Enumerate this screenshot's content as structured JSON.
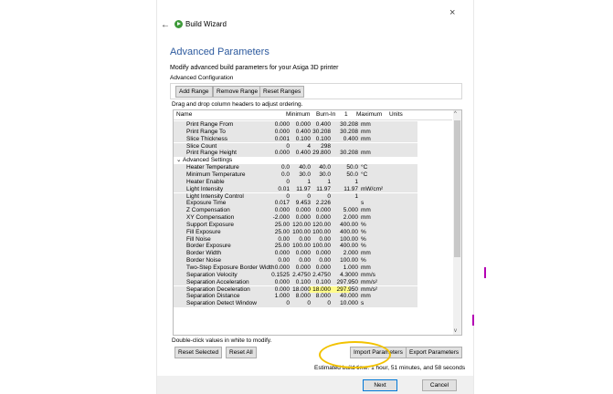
{
  "window": {
    "close_glyph": "×",
    "back_glyph": "←",
    "title": "Build Wizard"
  },
  "page": {
    "title": "Advanced Parameters",
    "description": "Modify advanced build parameters for your Asiga 3D printer",
    "group_label": "Advanced Configuration",
    "drag_hint": "Drag and drop column headers to adjust ordering.",
    "footer_note": "Double-click values in white to modify.",
    "estimated_time": "Estimated build time: 1 hour, 51 minutes, and 58 seconds"
  },
  "toolbar": {
    "add_range": "Add Range",
    "remove_range": "Remove Range",
    "reset_ranges": "Reset Ranges"
  },
  "bottom_buttons": {
    "reset_selected": "Reset Selected",
    "reset_all": "Reset All",
    "import_parameters": "Import Parameters",
    "export_parameters": "Export Parameters"
  },
  "nav": {
    "next": "Next",
    "cancel": "Cancel"
  },
  "table": {
    "columns": [
      "Name",
      "Minimum",
      "Burn-In",
      "1",
      "Maximum",
      "Units"
    ],
    "section_toggle": "⌄",
    "rows": [
      {
        "name": "Print Range From",
        "min": "0.000",
        "burn": "0.000",
        "one": "0.400",
        "max": "30.208",
        "unit": "mm"
      },
      {
        "name": "Print Range To",
        "min": "0.000",
        "burn": "0.400",
        "one": "30.208",
        "max": "30.208",
        "unit": "mm"
      },
      {
        "name": "Slice Thickness",
        "min": "0.001",
        "burn": "0.100",
        "one": "0.100",
        "max": "0.400",
        "unit": "mm"
      },
      {
        "name": "Slice Count",
        "min": "0",
        "burn": "4",
        "one": "298",
        "max": "",
        "unit": ""
      },
      {
        "name": "Print Range Height",
        "min": "0.000",
        "burn": "0.400",
        "one": "29.800",
        "max": "30.208",
        "unit": "mm"
      },
      {
        "name": "Advanced Settings",
        "section": true
      },
      {
        "name": "Heater Temperature",
        "min": "0.0",
        "burn": "40.0",
        "one": "40.0",
        "max": "50.0",
        "unit": "°C"
      },
      {
        "name": "Minimum Temperature",
        "min": "0.0",
        "burn": "30.0",
        "one": "30.0",
        "max": "50.0",
        "unit": "°C"
      },
      {
        "name": "Heater Enable",
        "min": "0",
        "burn": "1",
        "one": "1",
        "max": "1",
        "unit": ""
      },
      {
        "name": "Light Intensity",
        "min": "0.01",
        "burn": "11.97",
        "one": "11.97",
        "max": "11.97",
        "unit": "mW/cm²"
      },
      {
        "name": "Light Intensity Control",
        "min": "0",
        "burn": "0",
        "one": "0",
        "max": "1",
        "unit": ""
      },
      {
        "name": "Exposure Time",
        "min": "0.017",
        "burn": "9.453",
        "one": "2.226",
        "max": "",
        "unit": "s"
      },
      {
        "name": "Z Compensation",
        "min": "0.000",
        "burn": "0.000",
        "one": "0.000",
        "max": "5.000",
        "unit": "mm"
      },
      {
        "name": "XY Compensation",
        "min": "-2.000",
        "burn": "0.000",
        "one": "0.000",
        "max": "2.000",
        "unit": "mm"
      },
      {
        "name": "Support Exposure",
        "min": "25.00",
        "burn": "120.00",
        "one": "120.00",
        "max": "400.00",
        "unit": "%"
      },
      {
        "name": "Fill Exposure",
        "min": "25.00",
        "burn": "100.00",
        "one": "100.00",
        "max": "400.00",
        "unit": "%"
      },
      {
        "name": "Fill Noise",
        "min": "0.00",
        "burn": "0.00",
        "one": "0.00",
        "max": "100.00",
        "unit": "%"
      },
      {
        "name": "Border Exposure",
        "min": "25.00",
        "burn": "100.00",
        "one": "100.00",
        "max": "400.00",
        "unit": "%"
      },
      {
        "name": "Border Width",
        "min": "0.000",
        "burn": "0.000",
        "one": "0.000",
        "max": "2.000",
        "unit": "mm"
      },
      {
        "name": "Border Noise",
        "min": "0.00",
        "burn": "0.00",
        "one": "0.00",
        "max": "100.00",
        "unit": "%"
      },
      {
        "name": "Two-Step Exposure Border Width",
        "min": "0.000",
        "burn": "0.000",
        "one": "0.000",
        "max": "1.000",
        "unit": "mm"
      },
      {
        "name": "Separation Velocity",
        "min": "0.1525",
        "burn": "2.4750",
        "one": "2.4750",
        "max": "4.3000",
        "unit": "mm/s"
      },
      {
        "name": "Separation Acceleration",
        "min": "0.000",
        "burn": "0.100",
        "one": "0.100",
        "max": "297.950",
        "unit": "mm/s²"
      },
      {
        "name": "Separation Deceleration",
        "min": "0.000",
        "burn": "18.000",
        "one": "18.000",
        "max": "297.950",
        "unit": "mm/s²",
        "highlight": true
      },
      {
        "name": "Separation Distance",
        "min": "1.000",
        "burn": "8.000",
        "one": "8.000",
        "max": "40.000",
        "unit": "mm"
      },
      {
        "name": "Separation Detect Window",
        "min": "0",
        "burn": "0",
        "one": "0",
        "max": "10.000",
        "unit": "s"
      }
    ]
  },
  "colors": {
    "accent_title": "#2d5a9e",
    "highlight_values": "#fffb8a",
    "annotation_ring": "#f2c200",
    "side_marks": "#b400b4"
  }
}
